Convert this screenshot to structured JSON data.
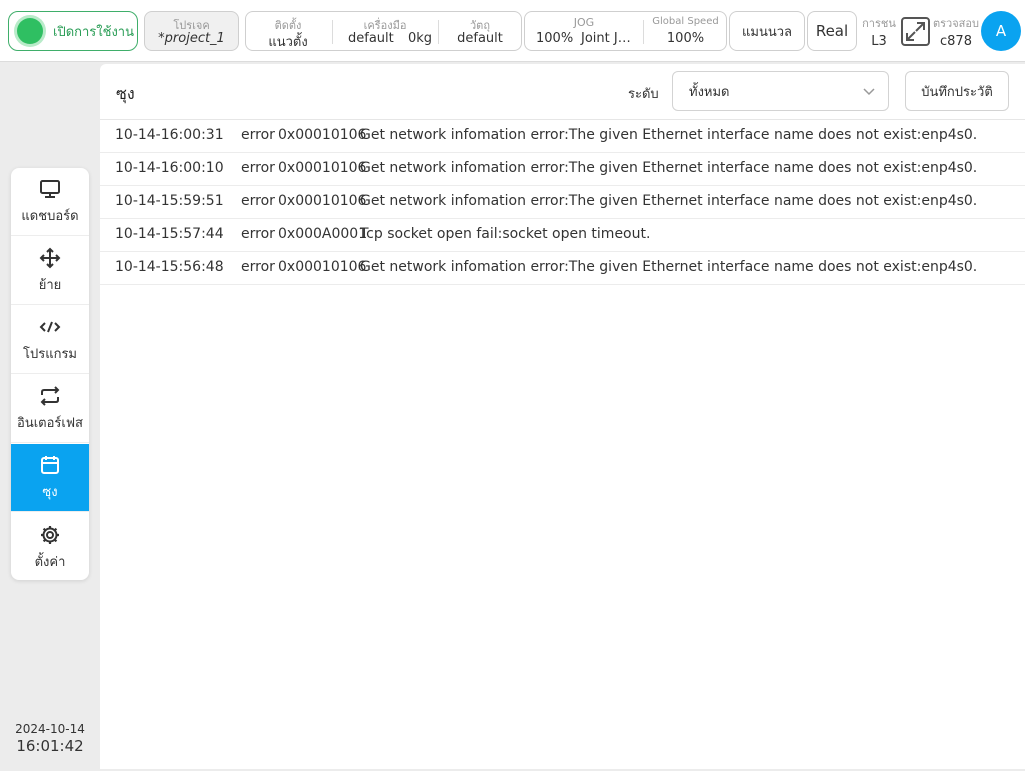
{
  "topbar": {
    "enable_label": "เปิดการใช้งาน",
    "project": {
      "label": "โปรเจค",
      "value": "*project_1"
    },
    "setup": {
      "mount": {
        "label": "ติดตั้ง",
        "value": "แนวตั้ง"
      },
      "tool": {
        "label": "เครื่องมือ",
        "value": "default",
        "weight": "0kg"
      },
      "object": {
        "label": "วัตถุ",
        "value": "default"
      }
    },
    "jog": {
      "label": "JOG",
      "percent": "100%",
      "mode": "Joint J…"
    },
    "global_speed": {
      "label": "Global Speed",
      "value": "100%"
    },
    "manual_label": "แมนนวล",
    "real_label": "Real",
    "collision": {
      "label": "การชน",
      "value": "L3"
    },
    "check": {
      "label": "ตรวจสอบ",
      "value": "c878"
    },
    "avatar_letter": "A"
  },
  "sidebar": {
    "items": [
      {
        "label": "แดชบอร์ด",
        "icon": "monitor-icon"
      },
      {
        "label": "ย้าย",
        "icon": "move-icon"
      },
      {
        "label": "โปรแกรม",
        "icon": "code-icon"
      },
      {
        "label": "อินเตอร์เฟส",
        "icon": "swap-icon"
      },
      {
        "label": "ซุง",
        "icon": "calendar-icon",
        "active": true
      },
      {
        "label": "ตั้งค่า",
        "icon": "gear-icon"
      }
    ],
    "date": "2024-10-14",
    "time": "16:01:42"
  },
  "log": {
    "title": "ซุง",
    "level_label": "ระดับ",
    "level_value": "ทั้งหมด",
    "save_label": "บันทึกประวัติ",
    "entries": [
      {
        "time": "10-14-16:00:31",
        "level": "error",
        "code": "0x00010106",
        "message": "Get network infomation error:The given Ethernet interface name does not exist:enp4s0."
      },
      {
        "time": "10-14-16:00:10",
        "level": "error",
        "code": "0x00010106",
        "message": "Get network infomation error:The given Ethernet interface name does not exist:enp4s0."
      },
      {
        "time": "10-14-15:59:51",
        "level": "error",
        "code": "0x00010106",
        "message": "Get network infomation error:The given Ethernet interface name does not exist:enp4s0."
      },
      {
        "time": "10-14-15:57:44",
        "level": "error",
        "code": "0x000A0001",
        "message": "Tcp socket open fail:socket open timeout."
      },
      {
        "time": "10-14-15:56:48",
        "level": "error",
        "code": "0x00010106",
        "message": "Get network infomation error:The given Ethernet interface name does not exist:enp4s0."
      }
    ]
  },
  "colors": {
    "accent": "#0aa3f0",
    "enabled": "#2fbf62"
  }
}
